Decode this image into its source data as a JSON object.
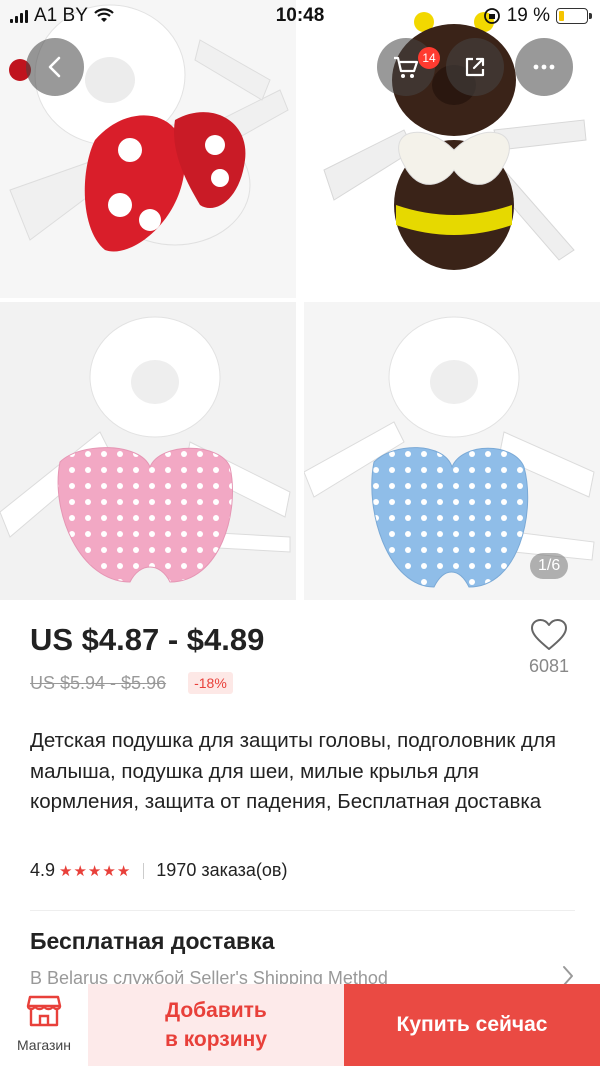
{
  "status_bar": {
    "carrier": "A1 BY",
    "time": "10:48",
    "battery_percent": "19 %",
    "battery_level": 0.19
  },
  "header": {
    "cart_count": "14",
    "back_icon": "chevron-left-icon",
    "cart_icon": "cart-icon",
    "share_icon": "share-icon",
    "more_icon": "more-dots-icon"
  },
  "gallery": {
    "counter": "1/6",
    "images": [
      "ladybug-pillow",
      "bee-pillow",
      "pink-wings-pillow",
      "blue-wings-pillow"
    ]
  },
  "product": {
    "price": "US $4.87 - $4.89",
    "old_price": "US $5.94 - $5.96",
    "discount": "-18%",
    "wishlist_count": "6081",
    "title": "Детская подушка для защиты головы, подголовник для малыша, подушка для шеи, милые крылья для кормления, защита от падения, Бесплатная доставка",
    "rating": "4.9",
    "stars": "★★★★★",
    "orders": "1970 заказа(ов)"
  },
  "shipping": {
    "title": "Бесплатная доставка",
    "subtitle": "В Belarus службой Seller's Shipping Method"
  },
  "bottom_bar": {
    "store_label": "Магазин",
    "add_to_cart": "Добавить\nв корзину",
    "buy_now": "Купить сейчас"
  },
  "colors": {
    "accent": "#ea4a43",
    "accent_light": "#fdeaea",
    "discount_text": "#e8403a"
  }
}
